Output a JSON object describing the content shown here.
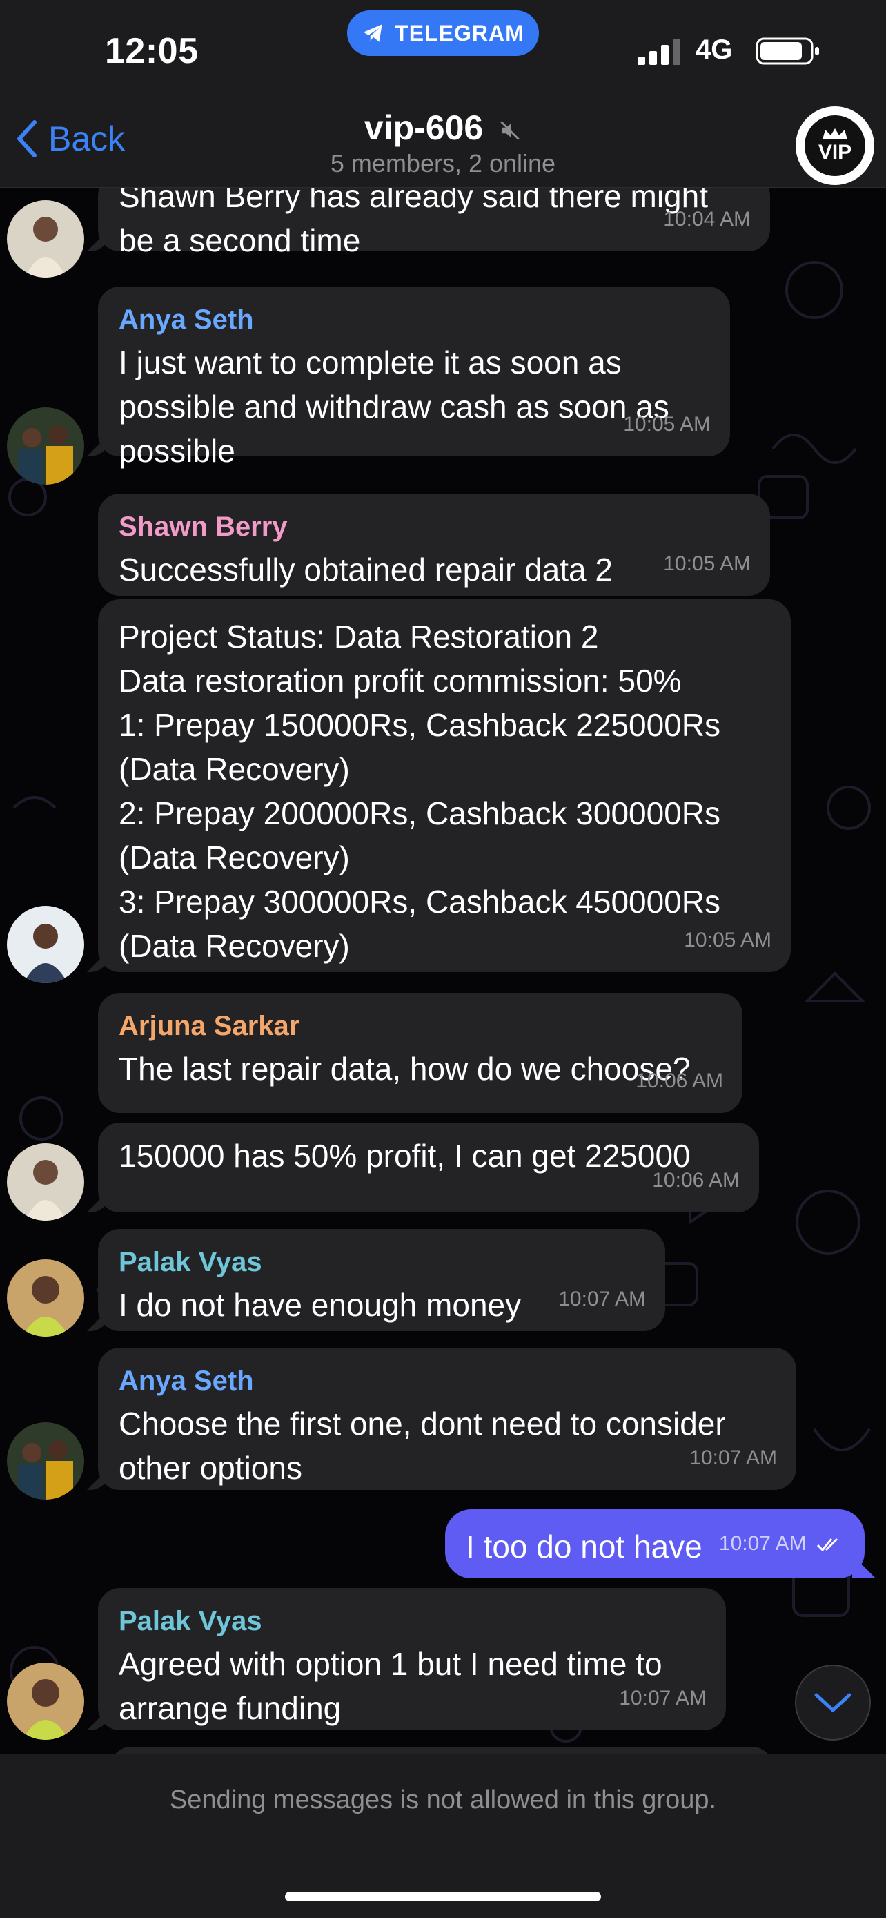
{
  "status_bar": {
    "time": "12:05",
    "app_pill": "TELEGRAM",
    "network": "4G"
  },
  "header": {
    "back_label": "Back",
    "title": "vip-606",
    "subtitle": "5 members, 2 online",
    "badge_text": "VIP"
  },
  "messages": [
    {
      "sender": "",
      "text_lines": [
        "Shawn Berry has already said there might",
        "be a second time"
      ],
      "time": "10:04 AM"
    },
    {
      "sender": "Anya Seth",
      "sender_color": "#6aa8ff",
      "text_lines": [
        "I just want to complete it as soon as",
        "possible and withdraw cash as soon as",
        "possible"
      ],
      "time": "10:05 AM"
    },
    {
      "sender": "Shawn Berry",
      "sender_color": "#f29ac8",
      "text_lines": [
        "Successfully obtained repair data 2"
      ],
      "time": "10:05 AM"
    },
    {
      "sender": "",
      "text_lines": [
        "Project Status: Data Restoration 2",
        "Data restoration profit commission: 50%",
        "1: Prepay 150000Rs, Cashback 225000Rs",
        "(Data Recovery)",
        "2: Prepay 200000Rs, Cashback 300000Rs",
        "(Data Recovery)",
        "3: Prepay 300000Rs, Cashback 450000Rs",
        "(Data Recovery)"
      ],
      "time": "10:05 AM"
    },
    {
      "sender": "Arjuna Sarkar",
      "sender_color": "#f5a66b",
      "text_lines": [
        "The last repair data, how do we choose?"
      ],
      "time": "10:06 AM"
    },
    {
      "sender": "",
      "text_lines": [
        "150000 has 50% profit, I can get 225000"
      ],
      "time": "10:06 AM"
    },
    {
      "sender": "Palak Vyas",
      "sender_color": "#6ec6d8",
      "text_lines": [
        "I do not have enough money"
      ],
      "time": "10:07 AM"
    },
    {
      "sender": "Anya Seth",
      "sender_color": "#6aa8ff",
      "text_lines": [
        "Choose the first one, dont need to consider",
        "other options"
      ],
      "time": "10:07 AM"
    },
    {
      "sender": "",
      "text_lines": [
        "I too do not have"
      ],
      "time": "10:07 AM",
      "outgoing": true
    },
    {
      "sender": "Palak Vyas",
      "sender_color": "#6ec6d8",
      "text_lines": [
        "Agreed with option 1 but I need time to",
        "arrange funding"
      ],
      "time": "10:07 AM"
    }
  ],
  "footer": {
    "notice": "Sending messages is not allowed in this group."
  },
  "colors": {
    "accent": "#3478f6",
    "outgoing_bubble": "#5e5cf2",
    "incoming_bubble": "#232325"
  }
}
